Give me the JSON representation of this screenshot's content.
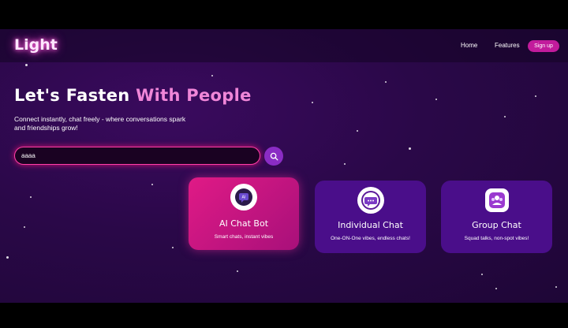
{
  "nav": {
    "logo": "Light",
    "links": [
      "Home",
      "Features"
    ],
    "signup_label": "Sign up"
  },
  "hero": {
    "headline_main": "Let's Fasten ",
    "headline_accent": "With People",
    "subtext": "Connect instantly, chat freely - where conversations spark and friendships grow!"
  },
  "search": {
    "value": "aaaa",
    "button_icon": "search-icon"
  },
  "cards": [
    {
      "title": "AI Chat Bot",
      "description": "Smart chats, instant vibes",
      "icon": "ai-chat-icon"
    },
    {
      "title": "Individual Chat",
      "description": "One-ON-One vibes, endless chats!",
      "icon": "chat-bubble-icon"
    },
    {
      "title": "Group Chat",
      "description": "Squad talks, non-spot vibes!",
      "icon": "group-chat-icon"
    }
  ],
  "colors": {
    "background": "#2a0848",
    "accent_pink": "#f086d8",
    "signup_button": "#c21b9c",
    "active_card": "#e01a86",
    "card": "#4a0e8a"
  }
}
